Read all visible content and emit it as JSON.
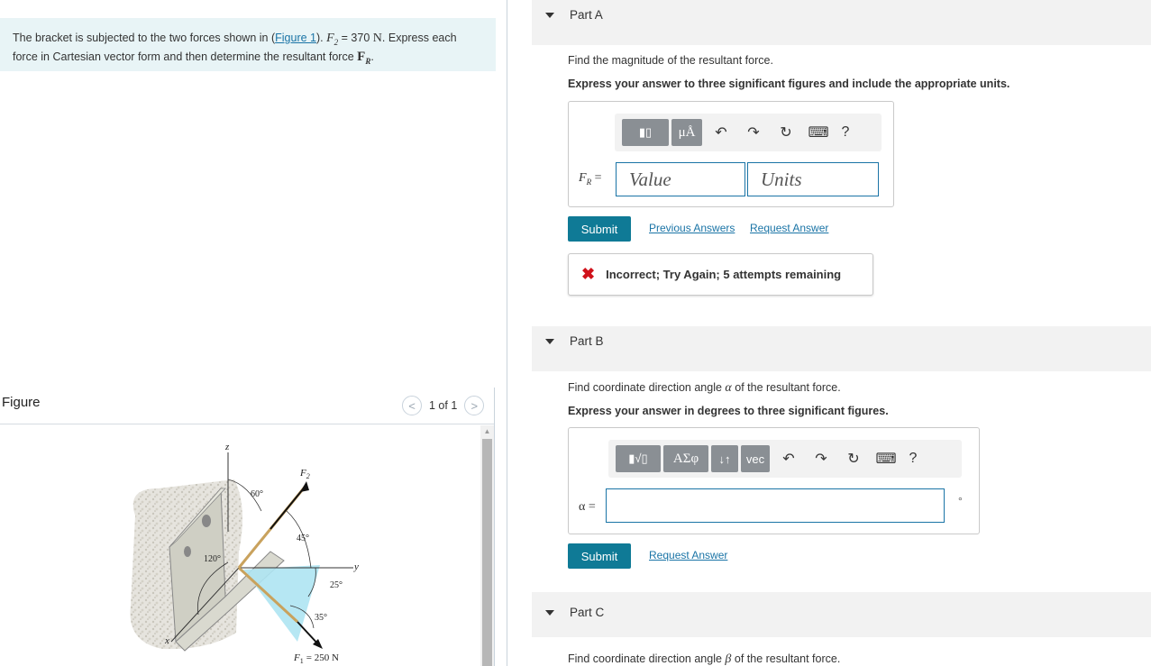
{
  "problem": {
    "text_before_link": "The bracket is subjected to the two forces shown in (",
    "figure_link": "Figure 1",
    "text_after_link": ").",
    "f2_symbol": "F",
    "f2_sub": "2",
    "f2_value": "= 370",
    "f2_unit": "N",
    "text_mid": ". Express each",
    "line2": "force in Cartesian vector form and then determine the resultant force",
    "fr_symbol": "F",
    "fr_sub": "R",
    "period": "."
  },
  "figure": {
    "title": "Figure",
    "count": "1 of 1",
    "prev": "<",
    "next": ">",
    "labels": {
      "z": "z",
      "f2": "F",
      "f2_sub": "2",
      "a60": "60°",
      "a45": "45°",
      "a120": "120°",
      "y": "y",
      "a25": "25°",
      "a35": "35°",
      "x": "x",
      "f1": "F",
      "f1_sub": "1",
      "f1_value": "= 250 N"
    }
  },
  "partA": {
    "label": "Part A",
    "prompt": "Find the magnitude of the resultant force.",
    "instruction": "Express your answer to three significant figures and include the appropriate units.",
    "toolbar": {
      "templates": "▮▯",
      "units": "μÅ",
      "undo": "↶",
      "redo": "↷",
      "reset": "↻",
      "keyboard": "⌨",
      "help": "?"
    },
    "field_label_sym": "F",
    "field_label_sub": "R",
    "field_label_eq": " =",
    "value_placeholder": "Value",
    "units_placeholder": "Units",
    "submit": "Submit",
    "previous_answers": "Previous Answers",
    "request_answer": "Request Answer",
    "feedback_icon": "✖",
    "feedback": "Incorrect; Try Again; 5 attempts remaining"
  },
  "partB": {
    "label": "Part B",
    "prompt_before": "Find coordinate direction angle ",
    "alpha": "α",
    "prompt_after": " of the resultant force.",
    "instruction": "Express your answer in degrees to three significant figures.",
    "toolbar": {
      "templates": "▮√▯",
      "greek": "ΑΣφ",
      "arrows": "↓↑",
      "vec": "vec",
      "undo": "↶",
      "redo": "↷",
      "reset": "↻",
      "keyboard": "⌨",
      "help": "?"
    },
    "field_label": "α =",
    "degree_unit": "°",
    "submit": "Submit",
    "request_answer": "Request Answer"
  },
  "partC": {
    "label": "Part C",
    "prompt_before": "Find coordinate direction angle ",
    "beta": "β",
    "prompt_after": " of the resultant force."
  },
  "colors": {
    "accent": "#0f7a96",
    "link": "#1a74a6",
    "error": "#d0121b",
    "problem_bg": "#e8f4f6"
  }
}
